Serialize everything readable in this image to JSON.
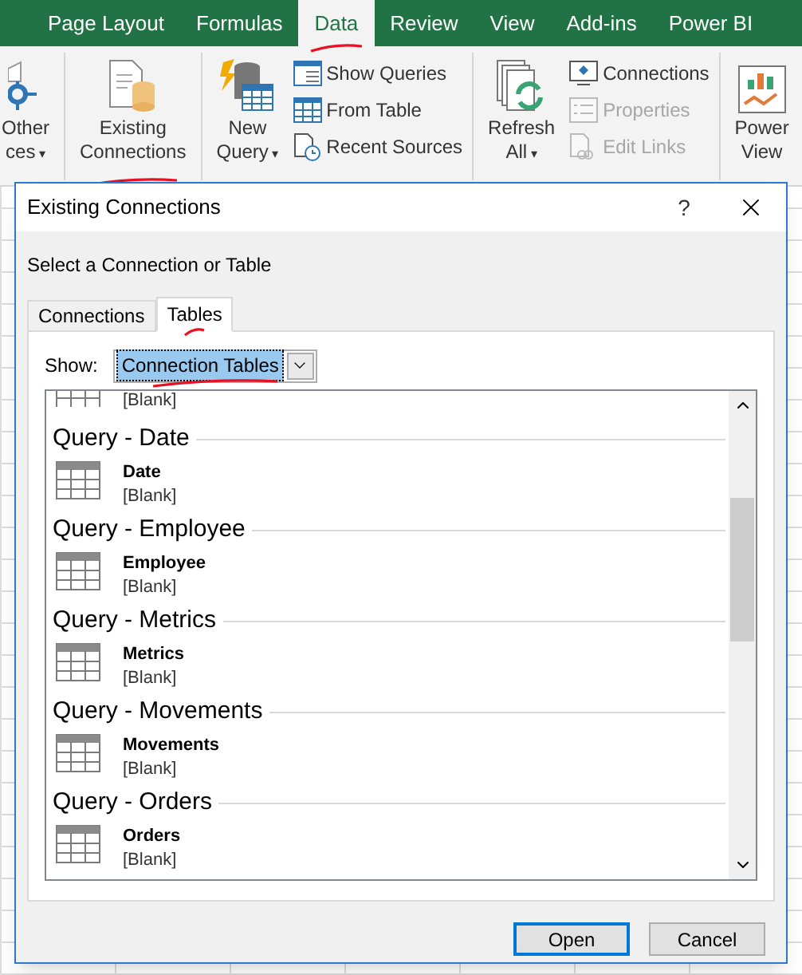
{
  "ribbon": {
    "tabs": [
      {
        "label": "Page Layout",
        "selected": false,
        "marked": false
      },
      {
        "label": "Formulas",
        "selected": false,
        "marked": false
      },
      {
        "label": "Data",
        "selected": true,
        "marked": true
      },
      {
        "label": "Review",
        "selected": false,
        "marked": false
      },
      {
        "label": "View",
        "selected": false,
        "marked": false
      },
      {
        "label": "Add-ins",
        "selected": false,
        "marked": false
      },
      {
        "label": "Power BI",
        "selected": false,
        "marked": false
      }
    ],
    "groups": [
      {
        "buttons": [
          {
            "kind": "large",
            "lines": [
              "Other",
              "ces"
            ],
            "caret": "▾",
            "marked": false
          }
        ]
      },
      {
        "buttons": [
          {
            "kind": "large",
            "lines": [
              "Existing",
              "Connections"
            ],
            "marked": true
          }
        ]
      },
      {
        "buttons": [
          {
            "kind": "large",
            "lines": [
              "New",
              "Query"
            ],
            "caret": "▾",
            "marked": false
          },
          {
            "kind": "small",
            "label": "Show Queries",
            "disabled": false
          },
          {
            "kind": "small",
            "label": "From Table",
            "disabled": false
          },
          {
            "kind": "small",
            "label": "Recent Sources",
            "disabled": false
          }
        ]
      },
      {
        "buttons": [
          {
            "kind": "large",
            "lines": [
              "Refresh",
              "All"
            ],
            "caret": "▾",
            "marked": false
          },
          {
            "kind": "small",
            "label": "Connections",
            "disabled": false
          },
          {
            "kind": "small",
            "label": "Properties",
            "disabled": true
          },
          {
            "kind": "small",
            "label": "Edit Links",
            "disabled": true
          }
        ]
      },
      {
        "buttons": [
          {
            "kind": "large",
            "lines": [
              "Power",
              "View"
            ],
            "marked": false
          }
        ]
      }
    ]
  },
  "dialog": {
    "title": "Existing Connections",
    "help": "?",
    "prompt": "Select a Connection or Table",
    "tabs": [
      {
        "label": "Connections",
        "selected": false,
        "marked": false
      },
      {
        "label": "Tables",
        "selected": true,
        "marked": true
      }
    ],
    "show_label": "Show:",
    "show_value": "Connection Tables",
    "show_marked": true,
    "entries": [
      {
        "kind": "partial",
        "description": "[Blank]"
      },
      {
        "kind": "query",
        "title": "Query - Date",
        "name": "Date",
        "description": "[Blank]"
      },
      {
        "kind": "query",
        "title": "Query - Employee",
        "name": "Employee",
        "description": "[Blank]"
      },
      {
        "kind": "query",
        "title": "Query - Metrics",
        "name": "Metrics",
        "description": "[Blank]"
      },
      {
        "kind": "query",
        "title": "Query - Movements",
        "name": "Movements",
        "description": "[Blank]"
      },
      {
        "kind": "query",
        "title": "Query - Orders",
        "name": "Orders",
        "description": "[Blank]"
      }
    ],
    "buttons": [
      {
        "label": "Open",
        "default": true
      },
      {
        "label": "Cancel",
        "default": false
      }
    ]
  }
}
